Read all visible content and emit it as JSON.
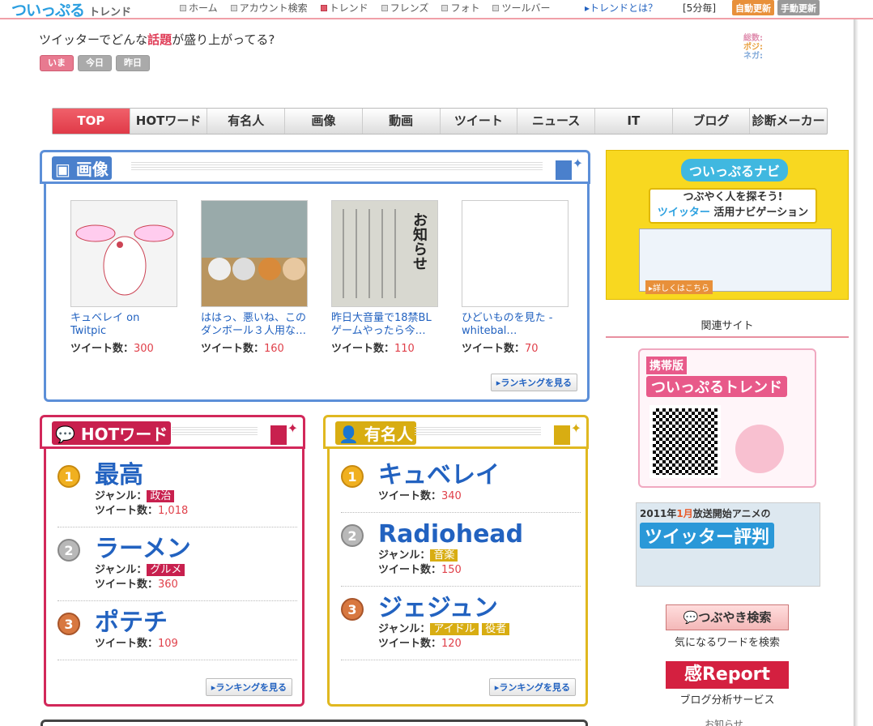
{
  "header": {
    "logo": "ついっぷる",
    "logo_sub": "トレンド",
    "nav": [
      "ホーム",
      "アカウント検索",
      "トレンド",
      "フレンズ",
      "フォト",
      "ツールバー"
    ],
    "whatis": "トレンドとは？",
    "interval": "[5分毎]",
    "auto_update": "自動更新",
    "manual_update": "手動更新"
  },
  "intro": {
    "question_pre": "ツイッターでどんな",
    "question_hl": "話題",
    "question_post": "が盛り上がってる?",
    "time_buttons": [
      "いま",
      "今日",
      "昨日"
    ],
    "legend": [
      "総数:",
      "ポジ:",
      "ネガ:"
    ]
  },
  "main_nav": [
    "TOP",
    "HOTワード",
    "有名人",
    "画像",
    "動画",
    "ツイート",
    "ニュース",
    "IT",
    "ブログ",
    "診断メーカー"
  ],
  "image_panel": {
    "title": "画像",
    "cards": [
      {
        "title": "キュベレイ on Twitpic",
        "count_label": "ツイート数：",
        "count": "300"
      },
      {
        "title": "ははっ、悪いね、このダンボール３人用な…",
        "count_label": "ツイート数：",
        "count": "160"
      },
      {
        "title": "昨日大音量で18禁BLゲームやったら今…",
        "count_label": "ツイート数：",
        "count": "110"
      },
      {
        "title": "ひどいものを見た - whitebal…",
        "count_label": "ツイート数：",
        "count": "70"
      }
    ],
    "thumb3_text": "お知らせ",
    "ranking_link": "ランキングを見る"
  },
  "hot_panel": {
    "title": "HOTワード",
    "items": [
      {
        "rank": "1",
        "word": "最高",
        "genre_label": "ジャンル：",
        "genres": [
          "政治"
        ],
        "count_label": "ツイート数：",
        "count": "1,018"
      },
      {
        "rank": "2",
        "word": "ラーメン",
        "genre_label": "ジャンル：",
        "genres": [
          "グルメ"
        ],
        "count_label": "ツイート数：",
        "count": "360"
      },
      {
        "rank": "3",
        "word": "ポテチ",
        "genre_label": "",
        "genres": [],
        "count_label": "ツイート数：",
        "count": "109"
      }
    ],
    "ranking_link": "ランキングを見る"
  },
  "celeb_panel": {
    "title": "有名人",
    "items": [
      {
        "rank": "1",
        "word": "キュベレイ",
        "genre_label": "",
        "genres": [],
        "count_label": "ツイート数：",
        "count": "340"
      },
      {
        "rank": "2",
        "word": "Radiohead",
        "genre_label": "ジャンル：",
        "genres": [
          "音楽"
        ],
        "count_label": "ツイート数：",
        "count": "150"
      },
      {
        "rank": "3",
        "word": "ジェジュン",
        "genre_label": "ジャンル：",
        "genres": [
          "アイドル",
          "役者"
        ],
        "count_label": "ツイート数：",
        "count": "120"
      }
    ],
    "ranking_link": "ランキングを見る"
  },
  "sidebar": {
    "navi_title": "ついっぷるナビ",
    "navi_line1": "つぶやく人を探そう!",
    "navi_line2_hl": "ツイッター",
    "navi_line2": "活用ナビゲーション",
    "navi_more": "詳しくはこちら",
    "related": "関連サイト",
    "mobile_tag": "携帯版",
    "mobile_title": "ついっぷるトレンド",
    "anime_line1_pre": "2011年",
    "anime_line1_hl": "1月",
    "anime_line1_post": "放送開始アニメの",
    "anime_line2": "ツイッター評判",
    "search_btn": "つぶやき検索",
    "search_caption": "気になるワードを検索",
    "report_btn": "感Report",
    "report_caption": "ブログ分析サービス",
    "bottom_text": "お知らせ"
  },
  "colors": {
    "image_accent": "#5c8fd8",
    "hot_accent": "#d2285a",
    "celeb_accent": "#e0b820",
    "link": "#2262c0",
    "count": "#e0404a"
  }
}
